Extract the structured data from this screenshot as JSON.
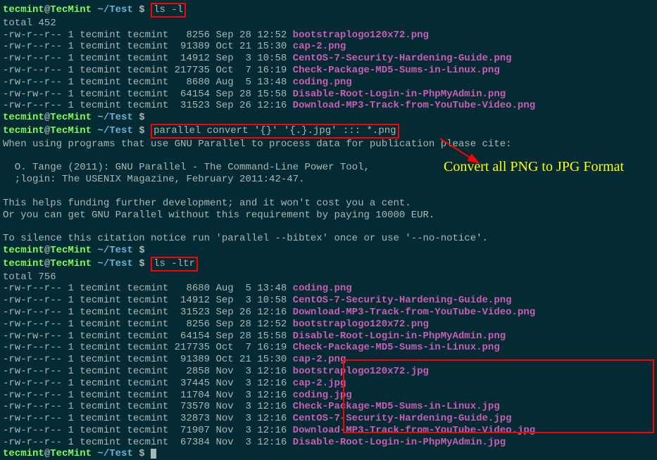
{
  "prompt": {
    "user": "tecmint",
    "at": "@",
    "host": "TecMint",
    "pathsep": " ~/",
    "path": "Test",
    "dollar": " $ "
  },
  "cmd1": "ls -l",
  "total1": "total 452",
  "ls1": [
    {
      "meta": "-rw-r--r-- 1 tecmint tecmint   8256 Sep 28 12:52 ",
      "file": "bootstraplogo120x72.png"
    },
    {
      "meta": "-rw-r--r-- 1 tecmint tecmint  91389 Oct 21 15:30 ",
      "file": "cap-2.png"
    },
    {
      "meta": "-rw-r--r-- 1 tecmint tecmint  14912 Sep  3 10:58 ",
      "file": "CentOS-7-Security-Hardening-Guide.png"
    },
    {
      "meta": "-rw-r--r-- 1 tecmint tecmint 217735 Oct  7 16:19 ",
      "file": "Check-Package-MD5-Sums-in-Linux.png"
    },
    {
      "meta": "-rw-r--r-- 1 tecmint tecmint   8680 Aug  5 13:48 ",
      "file": "coding.png"
    },
    {
      "meta": "-rw-rw-r-- 1 tecmint tecmint  64154 Sep 28 15:58 ",
      "file": "Disable-Root-Login-in-PhpMyAdmin.png"
    },
    {
      "meta": "-rw-r--r-- 1 tecmint tecmint  31523 Sep 26 12:16 ",
      "file": "Download-MP3-Track-from-YouTube-Video.png"
    }
  ],
  "cmd2": "parallel convert '{}' '{.}.jpg' ::: *.png",
  "citation": [
    "When using programs that use GNU Parallel to process data for publication please cite:",
    "",
    "  O. Tange (2011): GNU Parallel - The Command-Line Power Tool,",
    "  ;login: The USENIX Magazine, February 2011:42-47.",
    "",
    "This helps funding further development; and it won't cost you a cent.",
    "Or you can get GNU Parallel without this requirement by paying 10000 EUR.",
    "",
    "To silence this citation notice run 'parallel --bibtex' once or use '--no-notice'."
  ],
  "cmd3": "ls -ltr",
  "total2": "total 756",
  "ls2": [
    {
      "meta": "-rw-r--r-- 1 tecmint tecmint   8680 Aug  5 13:48 ",
      "file": "coding.png"
    },
    {
      "meta": "-rw-r--r-- 1 tecmint tecmint  14912 Sep  3 10:58 ",
      "file": "CentOS-7-Security-Hardening-Guide.png"
    },
    {
      "meta": "-rw-r--r-- 1 tecmint tecmint  31523 Sep 26 12:16 ",
      "file": "Download-MP3-Track-from-YouTube-Video.png"
    },
    {
      "meta": "-rw-r--r-- 1 tecmint tecmint   8256 Sep 28 12:52 ",
      "file": "bootstraplogo120x72.png"
    },
    {
      "meta": "-rw-rw-r-- 1 tecmint tecmint  64154 Sep 28 15:58 ",
      "file": "Disable-Root-Login-in-PhpMyAdmin.png"
    },
    {
      "meta": "-rw-r--r-- 1 tecmint tecmint 217735 Oct  7 16:19 ",
      "file": "Check-Package-MD5-Sums-in-Linux.png"
    },
    {
      "meta": "-rw-r--r-- 1 tecmint tecmint  91389 Oct 21 15:30 ",
      "file": "cap-2.png"
    },
    {
      "meta": "-rw-r--r-- 1 tecmint tecmint   2858 Nov  3 12:16 ",
      "file": "bootstraplogo120x72.jpg"
    },
    {
      "meta": "-rw-r--r-- 1 tecmint tecmint  37445 Nov  3 12:16 ",
      "file": "cap-2.jpg"
    },
    {
      "meta": "-rw-r--r-- 1 tecmint tecmint  11704 Nov  3 12:16 ",
      "file": "coding.jpg"
    },
    {
      "meta": "-rw-r--r-- 1 tecmint tecmint  73570 Nov  3 12:16 ",
      "file": "Check-Package-MD5-Sums-in-Linux.jpg"
    },
    {
      "meta": "-rw-r--r-- 1 tecmint tecmint  32873 Nov  3 12:16 ",
      "file": "CentOS-7-Security-Hardening-Guide.jpg"
    },
    {
      "meta": "-rw-r--r-- 1 tecmint tecmint  71907 Nov  3 12:16 ",
      "file": "Download-MP3-Track-from-YouTube-Video.jpg"
    },
    {
      "meta": "-rw-r--r-- 1 tecmint tecmint  67384 Nov  3 12:16 ",
      "file": "Disable-Root-Login-in-PhpMyAdmin.jpg"
    }
  ],
  "annotation": "Convert all PNG to JPG Format"
}
